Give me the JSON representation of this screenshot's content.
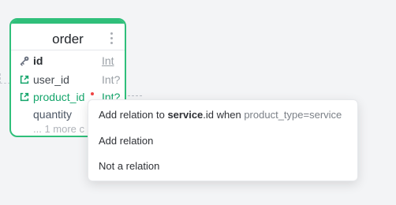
{
  "table": {
    "name": "order",
    "fields": [
      {
        "name": "id",
        "type": "Int",
        "icon": "key-icon"
      },
      {
        "name": "user_id",
        "type": "Int?",
        "icon": "external-link-icon"
      },
      {
        "name": "product_id",
        "type": "Int?",
        "icon": "external-link-icon"
      },
      {
        "name": "quantity",
        "type": ""
      }
    ],
    "more_fields": "... 1 more c"
  },
  "context_menu": {
    "items": [
      {
        "prefix": "Add relation to ",
        "entity": "service",
        "suffix": ".id when ",
        "condition": "product_type=service"
      },
      {
        "label": "Add relation"
      },
      {
        "label": "Not a relation"
      }
    ]
  },
  "colors": {
    "accent": "#2fbf7a",
    "relation_text": "#15a56b",
    "error": "#ef4444"
  }
}
